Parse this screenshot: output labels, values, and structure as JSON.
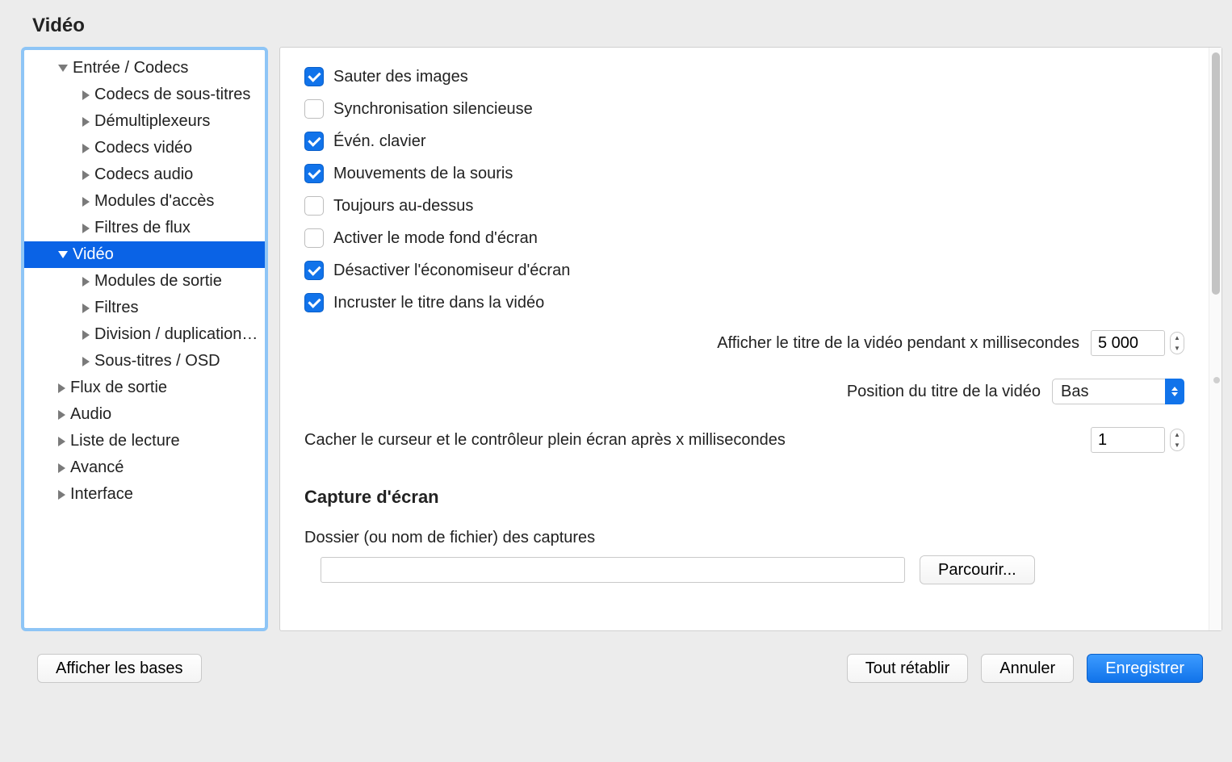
{
  "title": "Vidéo",
  "sidebar": {
    "items": [
      {
        "label": "Entrée / Codecs",
        "level": 1,
        "expanded": true,
        "selected": false
      },
      {
        "label": "Codecs de sous-titres",
        "level": 2,
        "expanded": false,
        "selected": false
      },
      {
        "label": "Démultiplexeurs",
        "level": 2,
        "expanded": false,
        "selected": false
      },
      {
        "label": "Codecs vidéo",
        "level": 2,
        "expanded": false,
        "selected": false
      },
      {
        "label": "Codecs audio",
        "level": 2,
        "expanded": false,
        "selected": false
      },
      {
        "label": "Modules d'accès",
        "level": 2,
        "expanded": false,
        "selected": false
      },
      {
        "label": "Filtres de flux",
        "level": 2,
        "expanded": false,
        "selected": false
      },
      {
        "label": "Vidéo",
        "level": 1,
        "expanded": true,
        "selected": true
      },
      {
        "label": "Modules de sortie",
        "level": 2,
        "expanded": false,
        "selected": false
      },
      {
        "label": "Filtres",
        "level": 2,
        "expanded": false,
        "selected": false
      },
      {
        "label": "Division / duplication…",
        "level": 2,
        "expanded": false,
        "selected": false
      },
      {
        "label": "Sous-titres / OSD",
        "level": 2,
        "expanded": false,
        "selected": false
      },
      {
        "label": "Flux de sortie",
        "level": 1,
        "expanded": false,
        "selected": false
      },
      {
        "label": "Audio",
        "level": 1,
        "expanded": false,
        "selected": false
      },
      {
        "label": "Liste de lecture",
        "level": 1,
        "expanded": false,
        "selected": false
      },
      {
        "label": "Avancé",
        "level": 1,
        "expanded": false,
        "selected": false
      },
      {
        "label": "Interface",
        "level": 1,
        "expanded": false,
        "selected": false
      }
    ]
  },
  "options": {
    "skip_frames": {
      "label": "Sauter des images",
      "checked": true
    },
    "quiet_sync": {
      "label": "Synchronisation silencieuse",
      "checked": false
    },
    "key_events": {
      "label": "Évén. clavier",
      "checked": true
    },
    "mouse_events": {
      "label": "Mouvements de la souris",
      "checked": true
    },
    "always_on_top": {
      "label": "Toujours au-dessus",
      "checked": false
    },
    "wallpaper_mode": {
      "label": "Activer le mode fond d'écran",
      "checked": false
    },
    "disable_screensaver": {
      "label": "Désactiver l'économiseur d'écran",
      "checked": true
    },
    "embed_title": {
      "label": "Incruster le titre dans la vidéo",
      "checked": true
    }
  },
  "fields": {
    "title_show_ms": {
      "label": "Afficher le titre de la vidéo pendant x millisecondes",
      "value": "5 000"
    },
    "title_position": {
      "label": "Position du titre de la vidéo",
      "value": "Bas"
    },
    "hide_cursor_ms": {
      "label": "Cacher le curseur et le contrôleur plein écran après x millisecondes",
      "value": "1"
    }
  },
  "capture": {
    "header": "Capture d'écran",
    "folder_label": "Dossier (ou nom de fichier) des captures",
    "folder_value": "",
    "browse": "Parcourir..."
  },
  "footer": {
    "show_basic": "Afficher les bases",
    "reset_all": "Tout rétablir",
    "cancel": "Annuler",
    "save": "Enregistrer"
  }
}
